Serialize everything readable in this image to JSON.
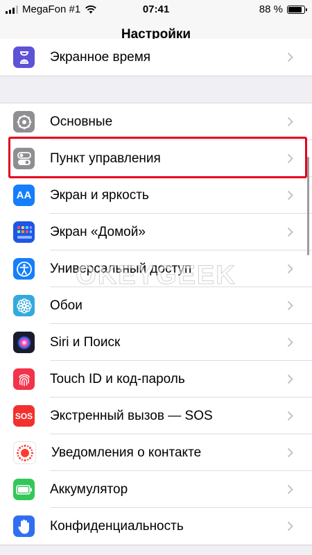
{
  "status_bar": {
    "carrier": "MegaFon #1",
    "time": "07:41",
    "battery_percent_label": "88 %",
    "battery_level": 0.88
  },
  "nav": {
    "title": "Настройки"
  },
  "top_item": {
    "label": "Экранное время",
    "icon": "hourglass-icon",
    "color": "#5e52d6"
  },
  "items": [
    {
      "label": "Основные",
      "icon": "gear-icon",
      "color": "#8e8e93"
    },
    {
      "label": "Пункт управления",
      "icon": "toggles-icon",
      "color": "#8e8e93"
    },
    {
      "label": "Экран и яркость",
      "icon": "text-size-icon",
      "color": "#157efb",
      "glyph": "AA"
    },
    {
      "label": "Экран «Домой»",
      "icon": "app-grid-icon",
      "color": "#1e57e6"
    },
    {
      "label": "Универсальный доступ",
      "icon": "accessibility-icon",
      "color": "#157efb"
    },
    {
      "label": "Обои",
      "icon": "flower-icon",
      "color": "#34aadc"
    },
    {
      "label": "Siri и Поиск",
      "icon": "siri-icon",
      "color": "#1b1b2e"
    },
    {
      "label": "Touch ID и код-пароль",
      "icon": "fingerprint-icon",
      "color": "#f2334a"
    },
    {
      "label": "Экстренный вызов — SOS",
      "icon": "sos-icon",
      "color": "#f2302d",
      "glyph": "SOS"
    },
    {
      "label": "Уведомления о контакте",
      "icon": "exposure-icon",
      "color": "#ffffff"
    },
    {
      "label": "Аккумулятор",
      "icon": "battery-icon",
      "color": "#33c759"
    },
    {
      "label": "Конфиденциальность",
      "icon": "hand-icon",
      "color": "#2f6ff2"
    }
  ],
  "highlight_color": "#e3001b",
  "watermark": "OKEYGEEK"
}
